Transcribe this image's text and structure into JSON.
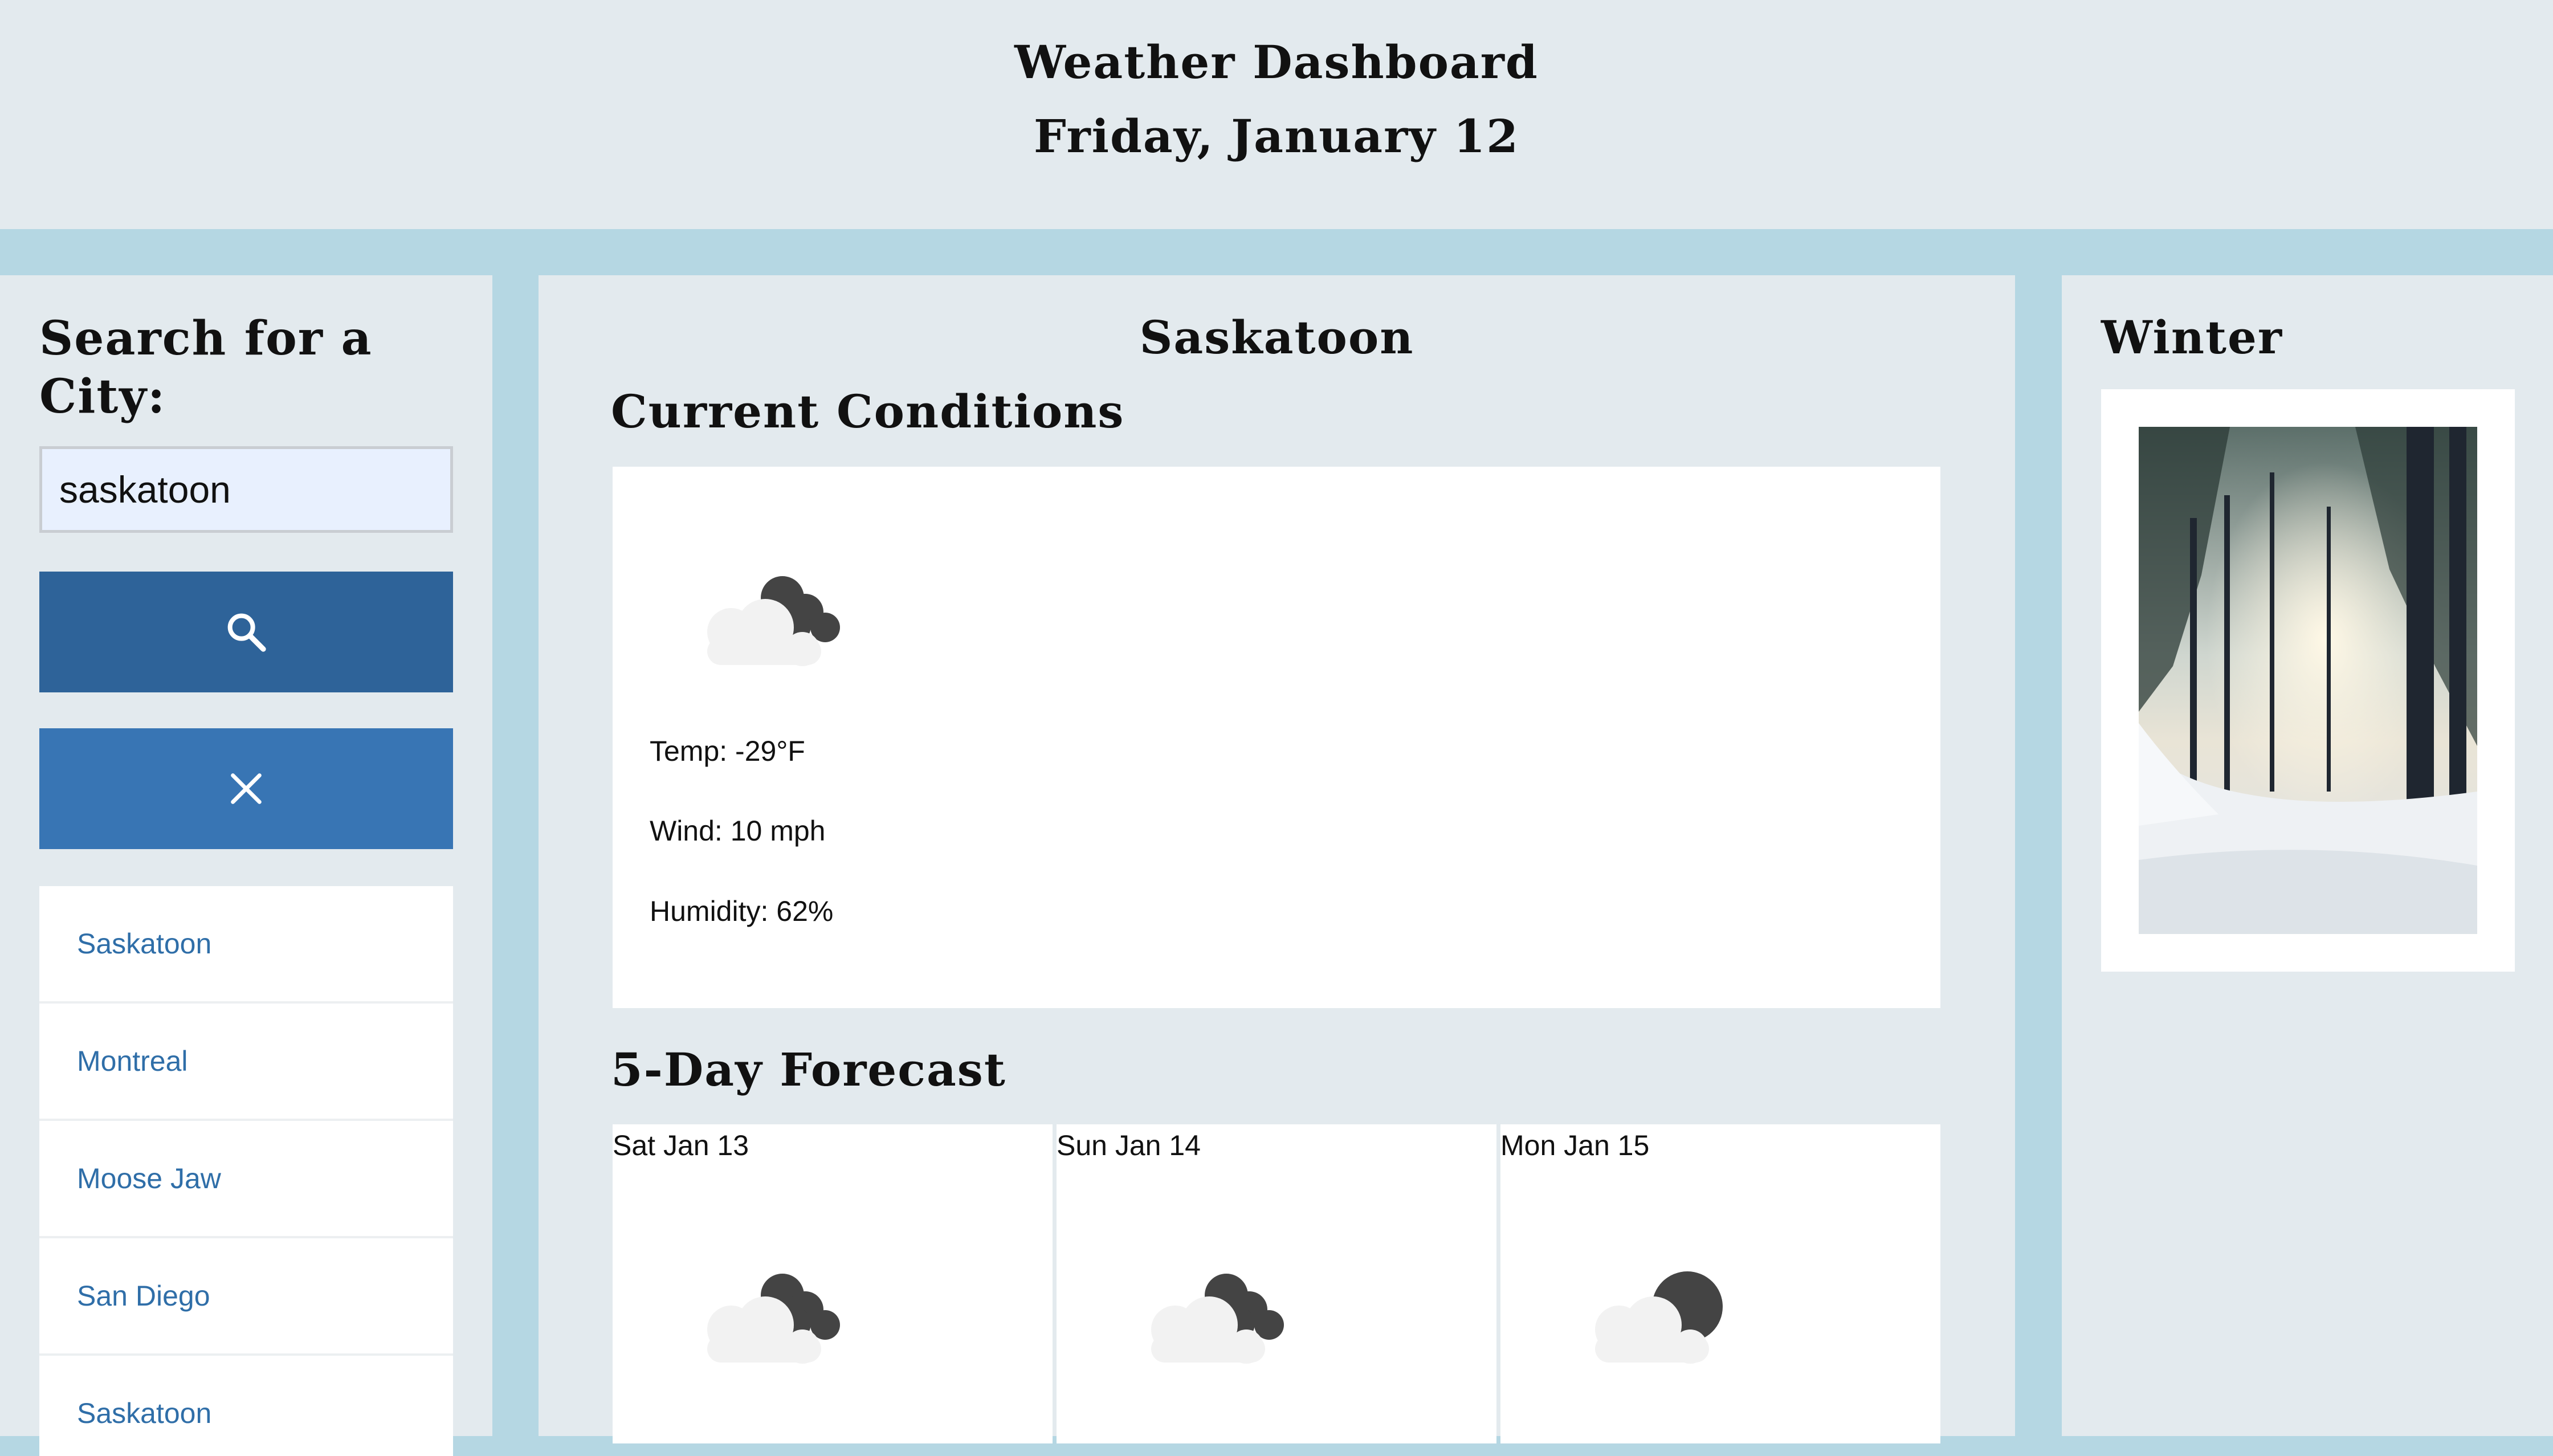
{
  "header": {
    "title": "Weather Dashboard",
    "date": "Friday, January 12"
  },
  "sidebar": {
    "search_title": "Search for a City:",
    "search_value": "saskatoon",
    "search_icon": "search-icon",
    "clear_icon": "close-icon",
    "history": [
      "Saskatoon",
      "Montreal",
      "Moose Jaw",
      "San Diego",
      "Saskatoon"
    ]
  },
  "main": {
    "city": "Saskatoon",
    "current_title": "Current Conditions",
    "current": {
      "icon": "cloud-moon-icon",
      "temp": "Temp: -29°F",
      "wind": "Wind: 10 mph",
      "humidity": "Humidity: 62%"
    },
    "forecast_title": "5-Day Forecast",
    "forecast": [
      {
        "date": "Sat Jan 13",
        "icon": "cloud-moon-icon"
      },
      {
        "date": "Sun Jan 14",
        "icon": "cloud-moon-icon"
      },
      {
        "date": "Mon Jan 15",
        "icon": "cloud-moon-icon"
      }
    ]
  },
  "aside": {
    "season": "Winter",
    "image": "winter-forest-photo"
  },
  "colors": {
    "header_bg": "#e3eaee",
    "page_bg": "#b5d7e3",
    "search_button": "#2e6399",
    "clear_button": "#3875b4",
    "link": "#2f6ea8"
  }
}
